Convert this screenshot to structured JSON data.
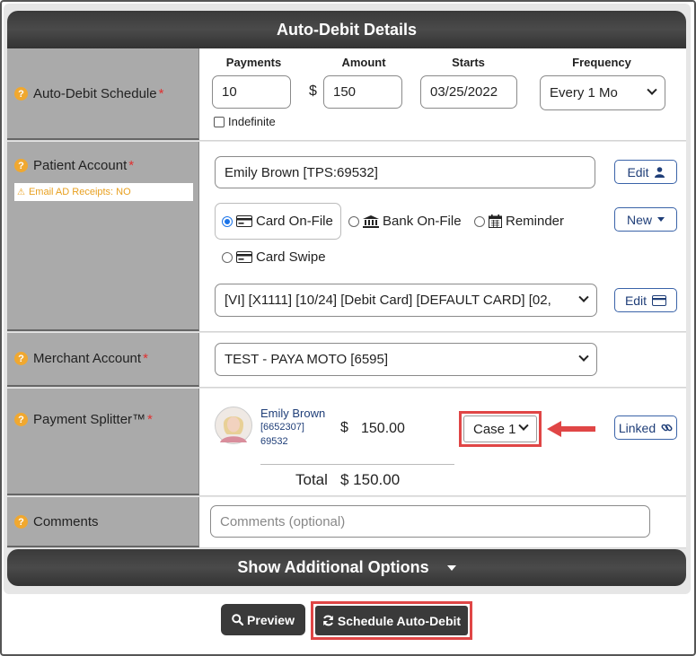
{
  "header": {
    "title": "Auto-Debit Details"
  },
  "schedule": {
    "label": "Auto-Debit Schedule",
    "required": "*",
    "payments_header": "Payments",
    "amount_header": "Amount",
    "starts_header": "Starts",
    "frequency_header": "Frequency",
    "payments_value": "10",
    "currency_symbol": "$",
    "amount_value": "150",
    "starts_value": "03/25/2022",
    "frequency_value": "Every 1 Mo",
    "indefinite_label": "Indefinite"
  },
  "patient": {
    "label": "Patient Account",
    "required": "*",
    "warning": "Email AD Receipts: NO",
    "account_value": "Emily Brown [TPS:69532]",
    "edit_label": "Edit",
    "new_label": "New",
    "methods": [
      "Card On-File",
      "Bank On-File",
      "Reminder",
      "Card Swipe"
    ],
    "card_value": "[VI] [X1111] [10/24] [Debit Card] [DEFAULT CARD] [02,",
    "card_edit_label": "Edit"
  },
  "merchant": {
    "label": "Merchant Account",
    "required": "*",
    "value": "TEST - PAYA MOTO [6595]"
  },
  "splitter": {
    "label": "Payment Splitter™",
    "required": "*",
    "name": "Emily Brown",
    "id1": "[6652307]",
    "id2": "69532",
    "currency_symbol": "$",
    "amount": "150.00",
    "case_value": "Case 1",
    "linked_label": "Linked",
    "total_label": "Total",
    "total_value": "$ 150.00"
  },
  "comments": {
    "label": "Comments",
    "placeholder": "Comments (optional)"
  },
  "more_options": {
    "label": "Show Additional Options"
  },
  "actions": {
    "preview_label": "Preview",
    "schedule_label": "Schedule Auto-Debit"
  },
  "colors": {
    "highlight": "#e04646",
    "accent": "#1f3e78",
    "warning": "#f0a830"
  }
}
